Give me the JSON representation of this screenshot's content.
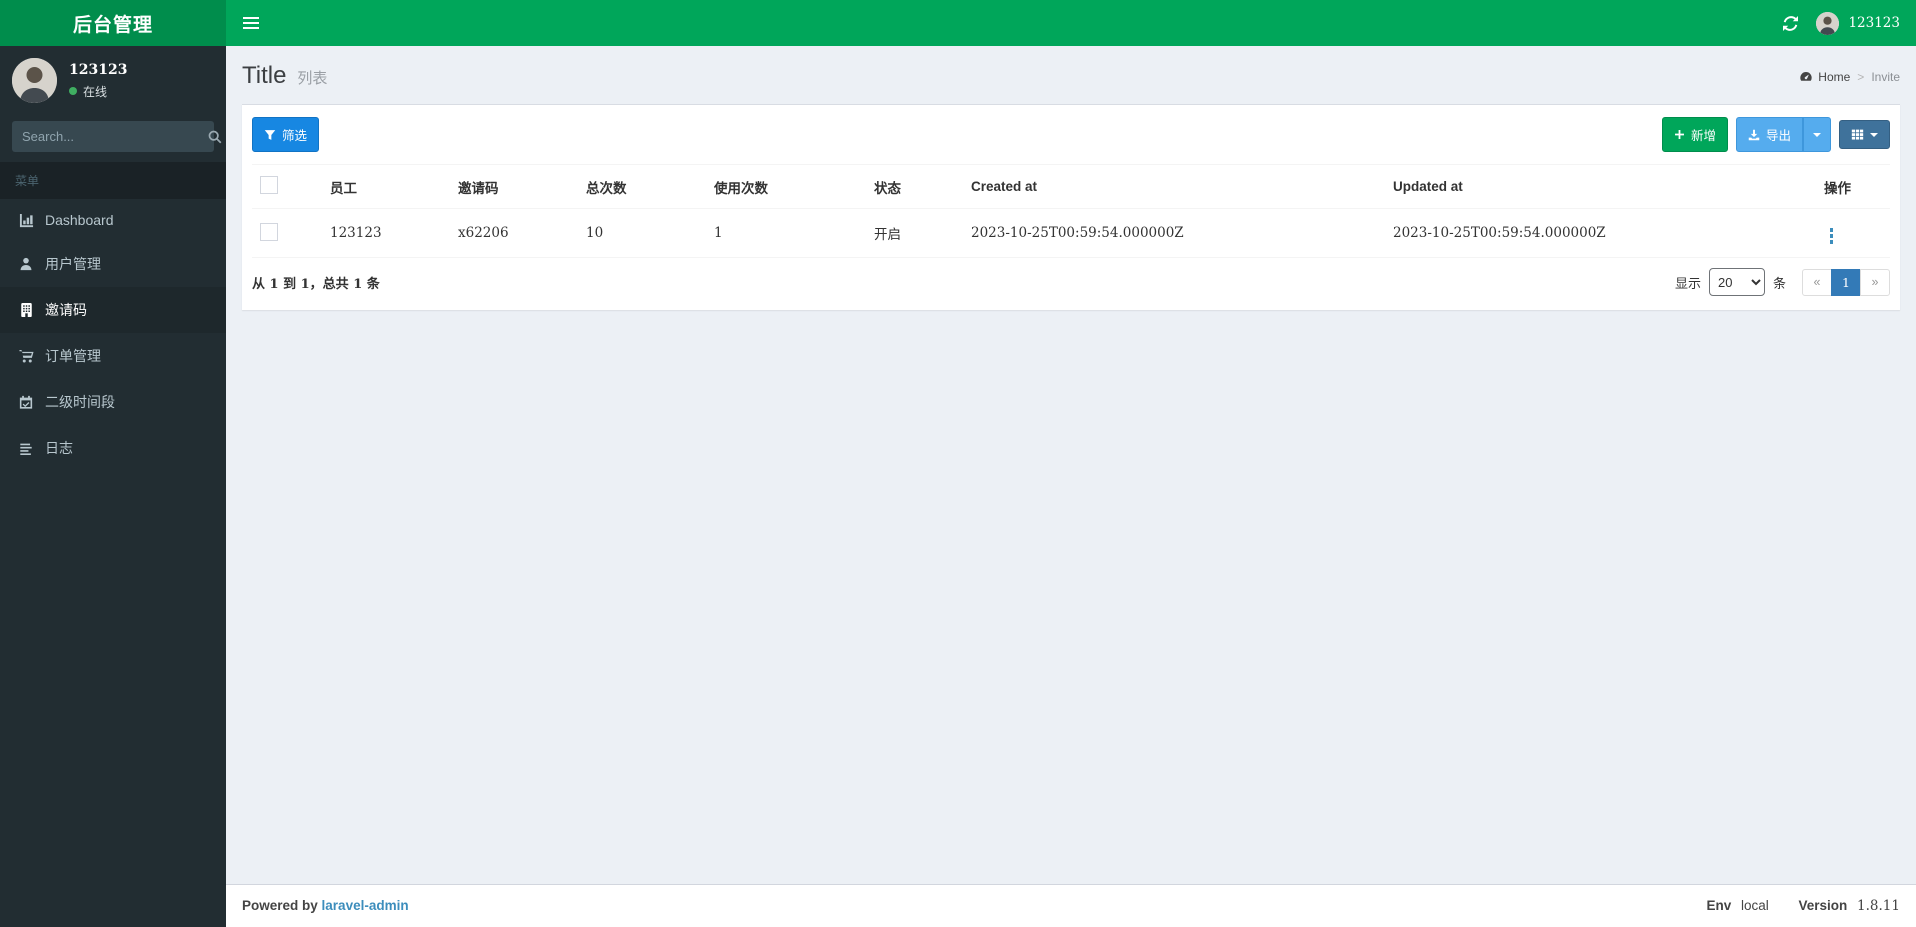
{
  "app": {
    "brand": "后台管理",
    "colors": {
      "logo_bg": "#008d4c",
      "navbar_bg": "#00a65a",
      "sidebar_bg": "#222d32",
      "filter_btn": "#1787e2",
      "add_btn": "#00a65a",
      "export_btn": "#55acee",
      "grid_btn": "#3f729b",
      "pagination_active": "#337ab7",
      "link": "#3c8dbc"
    }
  },
  "navbar": {
    "username": "123123"
  },
  "sidebar": {
    "user": {
      "name": "123123",
      "status": "在线"
    },
    "search_placeholder": "Search...",
    "section_label": "菜单",
    "items": [
      {
        "label": "Dashboard"
      },
      {
        "label": "用户管理"
      },
      {
        "label": "邀请码"
      },
      {
        "label": "订单管理"
      },
      {
        "label": "二级时间段"
      },
      {
        "label": "日志"
      }
    ]
  },
  "page": {
    "title": "Title",
    "subtitle": "列表",
    "breadcrumb": {
      "home": "Home",
      "separator": ">",
      "current": "Invite"
    }
  },
  "toolbar": {
    "filter_label": "筛选",
    "add_label": "新增",
    "export_label": "导出"
  },
  "table": {
    "headers": [
      "员工",
      "邀请码",
      "总次数",
      "使用次数",
      "状态",
      "Created at",
      "Updated at",
      "操作"
    ],
    "rows": [
      {
        "employee": "123123",
        "code": "x62206",
        "total": "10",
        "used": "1",
        "status": "开启",
        "created_at": "2023-10-25T00:59:54.000000Z",
        "updated_at": "2023-10-25T00:59:54.000000Z"
      }
    ]
  },
  "pagination": {
    "summary": "从 1 到 1，总共 1 条",
    "show_label": "显示",
    "per_page": "20",
    "unit_label": "条",
    "prev": "«",
    "page": "1",
    "next": "»"
  },
  "footer": {
    "powered_by": "Powered by",
    "powered_link": "laravel-admin",
    "env_label": "Env",
    "env_value": "local",
    "version_label": "Version",
    "version_value": "1.8.11"
  }
}
